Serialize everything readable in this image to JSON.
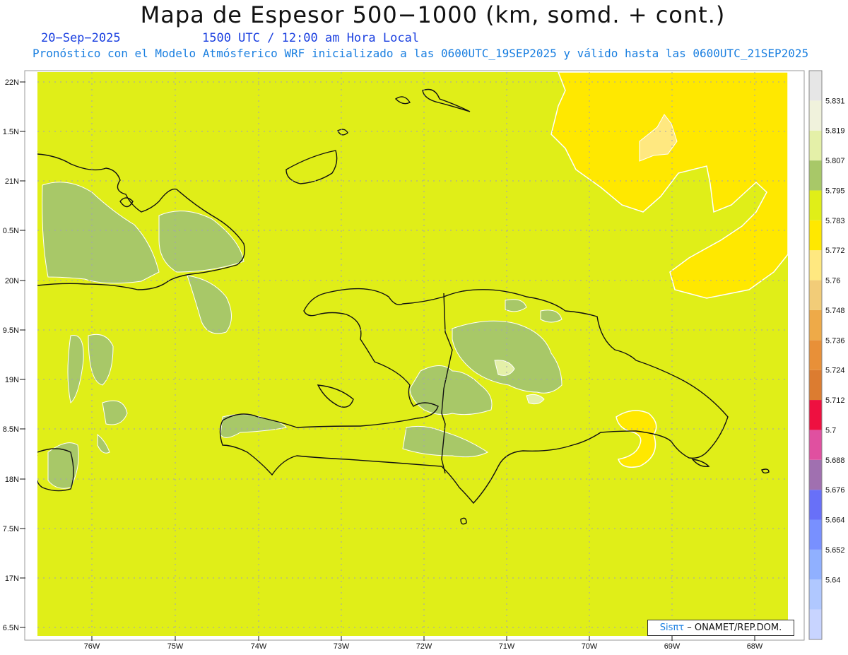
{
  "title": "Mapa de Espesor 500−1000 (km, somd. + cont.)",
  "date": "20−Sep−2025",
  "time": "1500 UTC / 12:00 am Hora Local",
  "forecast_note": "Pronóstico con el Modelo Atmósferico WRF inicializado a las 0600UTC_19SEP2025 y válido hasta las  0600UTC_21SEP2025",
  "lat_labels": [
    "22N",
    "1.5N",
    "21N",
    "0.5N",
    "20N",
    "9.5N",
    "19N",
    "8.5N",
    "18N",
    "7.5N",
    "17N",
    "6.5N"
  ],
  "lon_labels": [
    "76W",
    "75W",
    "74W",
    "73W",
    "72W",
    "71W",
    "70W",
    "69W",
    "68W"
  ],
  "colorbar": [
    {
      "label": "5.831",
      "color": "#f0f2dc"
    },
    {
      "label": "5.819",
      "color": "#e4f0a8"
    },
    {
      "label": "5.807",
      "color": "#a8c868"
    },
    {
      "label": "5.795",
      "color": "#e0ee18"
    },
    {
      "label": "5.783",
      "color": "#ffe800"
    },
    {
      "label": "5.772",
      "color": "#ffe880"
    },
    {
      "label": "5.76",
      "color": "#f2cc78"
    },
    {
      "label": "5.748",
      "color": "#eeaa48"
    },
    {
      "label": "5.736",
      "color": "#e89038"
    },
    {
      "label": "5.724",
      "color": "#dc7c30"
    },
    {
      "label": "5.712",
      "color": "#ee1040"
    },
    {
      "label": "5.7",
      "color": "#e050a0"
    },
    {
      "label": "5.688",
      "color": "#a070b0"
    },
    {
      "label": "5.676",
      "color": "#6870f8"
    },
    {
      "label": "5.664",
      "color": "#7890ff"
    },
    {
      "label": "5.652",
      "color": "#90b0ff"
    },
    {
      "label": "5.64",
      "color": "#b0c8ff"
    }
  ],
  "colorbar_top_color": "#e6e6e6",
  "colorbar_bottom_color": "#c8d4ff",
  "credit": {
    "brand": "Sisπτ",
    "text": "– ONAMET/REP.DOM."
  }
}
